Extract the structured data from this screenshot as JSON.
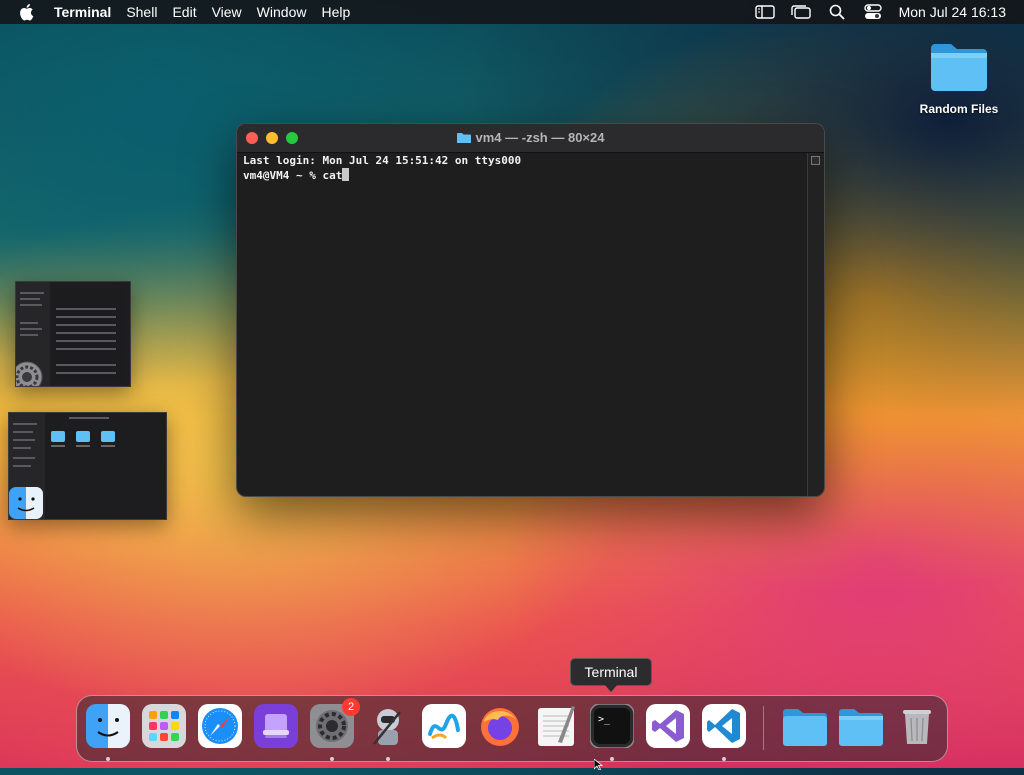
{
  "menubar": {
    "app_name": "Terminal",
    "menus": [
      "Shell",
      "Edit",
      "View",
      "Window",
      "Help"
    ],
    "clock": "Mon Jul 24  16:13"
  },
  "desktop": {
    "folder_label": "Random Files"
  },
  "terminal": {
    "title": "vm4 — -zsh — 80×24",
    "line1": "Last login: Mon Jul 24 15:51:42 on ttys000",
    "prompt": "vm4@VM4 ~ % cat"
  },
  "tooltip": "Terminal",
  "dock": {
    "badge_settings": "2"
  },
  "colors": {
    "traffic_red": "#ff5f57",
    "traffic_yellow": "#febc2e",
    "traffic_green": "#28c840",
    "folder_blue": "#39a8ea"
  }
}
